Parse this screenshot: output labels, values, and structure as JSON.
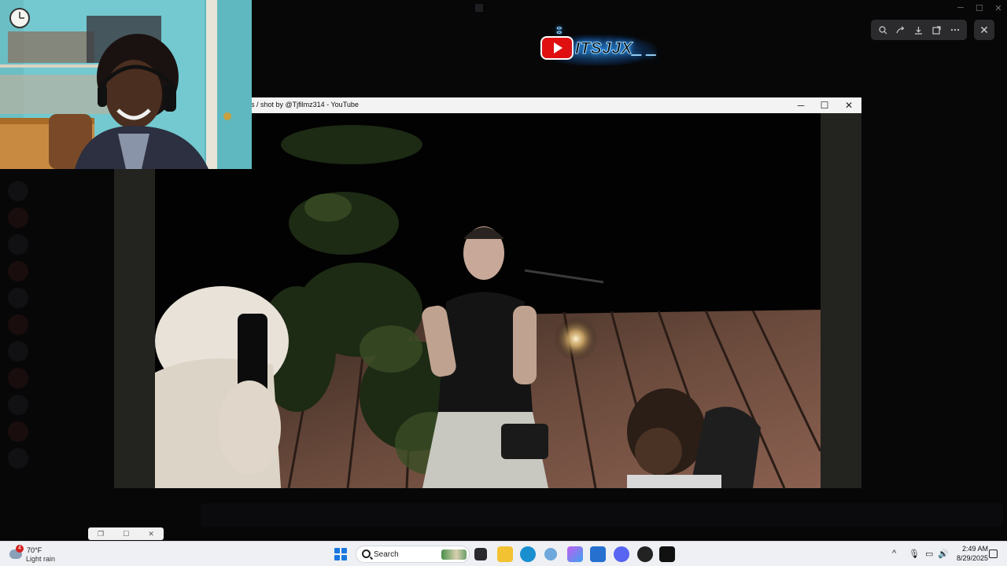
{
  "viewer_toolbar": {
    "zoom_icon": "magnifier-icon",
    "share_icon": "share-icon",
    "download_icon": "download-icon",
    "open_icon": "open-external-icon",
    "more_icon": "more-icon",
    "close_icon": "close-icon"
  },
  "logo": {
    "text": "ITSJJX_ _",
    "icon": "youtube-icon"
  },
  "youtube_window": {
    "title": "s / shot by @Tjfilmz314 - YouTube",
    "minimize": "─",
    "maximize": "☐",
    "close": "✕"
  },
  "mini_window": {
    "restore": "❐",
    "maximize": "☐",
    "close": "✕"
  },
  "taskbar": {
    "weather_badge": "4",
    "weather_temp": "70°F",
    "weather_desc": "Light rain",
    "search_placeholder": "Search",
    "time": "2:49 AM",
    "date": "8/29/2025",
    "tray": {
      "chevron": "^",
      "mic": "🎙",
      "network": "▭",
      "volume": "🔊"
    }
  },
  "colors": {
    "accent_blue": "#1978e0",
    "taskbar_bg": "#eef0f4",
    "logo_glow": "#38a8ff"
  }
}
